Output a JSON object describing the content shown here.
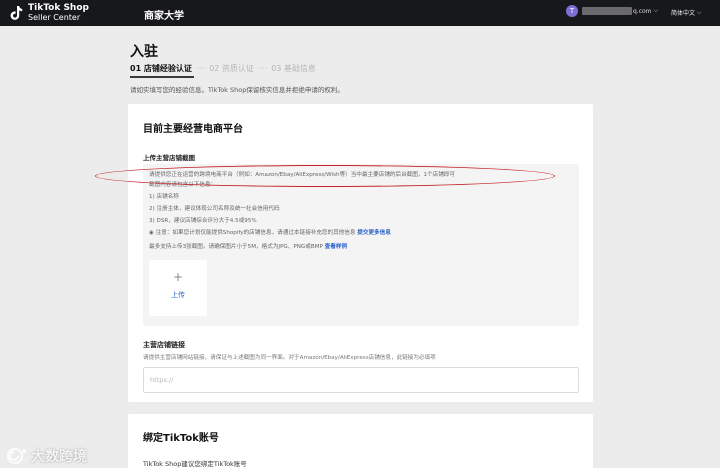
{
  "header": {
    "logo_line1": "TikTok Shop",
    "logo_line2": "Seller Center",
    "nav_item": "商家大学",
    "account_initial": "T",
    "account_suffix": "q.com",
    "language": "简体中文"
  },
  "page": {
    "title": "入驻",
    "steps": [
      {
        "label": "01 店铺经验认证"
      },
      {
        "label": "02 资质认证"
      },
      {
        "label": "03 基础信息"
      }
    ],
    "step_separator": "······",
    "intro": "请如实填写您的经验信息。TikTok Shop保留核实信息并拒绝申请的权利。"
  },
  "main_platform": {
    "title": "目前主要经营电商平台",
    "upload_label": "上传主营店铺截图",
    "info_lines": [
      "请提供您正在运营的跨境电商平台（例如：Amazon/Ebay/AliExpress/Wish等）当中最主要店铺的后台截图，1个店铺即可",
      "截图内容请包含以下信息：",
      "1) 店铺名称",
      "2) 注册主体，建议体现公司名称及统一社会信用代码",
      "3) DSR，建议店铺综合评分大于4.5或95%"
    ],
    "notice_text": "◉ 注意：如果您计划仅能提供Shopify的店铺信息，请通过本链接补充您的其他信息",
    "notice_link": "提交更多信息",
    "limit_text": "最多支持上传3张截图。请确保图片小于5M，格式为JPG、PNG或BMP",
    "limit_link": "查看样例",
    "upload_plus": "+",
    "upload_button": "上传",
    "store_link_label": "主营店铺链接",
    "store_link_desc": "请提供主营店铺网站链接，请保证与上述截图为同一界面。对于Amazon/Ebay/AliExpress店铺信息，此链接为必填项",
    "store_link_placeholder": "https://"
  },
  "bind_tiktok": {
    "title": "绑定TikTok账号",
    "subtitle": "TikTok Shop建议您绑定TikTok账号"
  },
  "watermark": {
    "text": "大数跨境"
  },
  "colors": {
    "topbar": "#17181c",
    "link": "#2d63c8",
    "annotation": "#c4242a",
    "avatar": "#7b6fd6"
  }
}
